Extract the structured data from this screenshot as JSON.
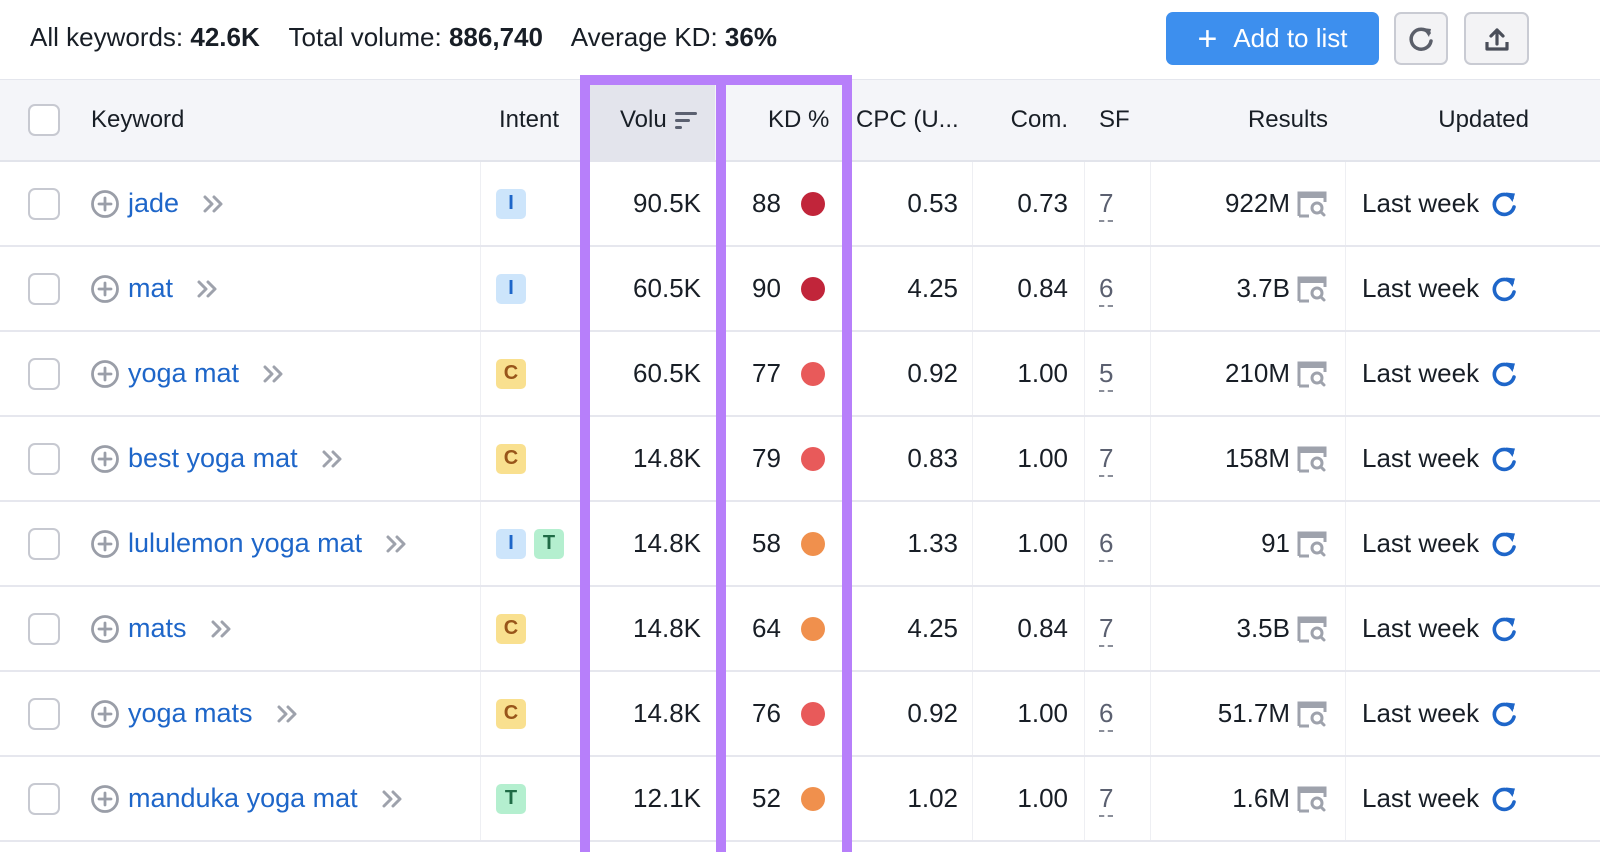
{
  "summary": {
    "all_keywords_label": "All keywords:",
    "all_keywords_value": "42.6K",
    "total_volume_label": "Total volume:",
    "total_volume_value": "886,740",
    "average_kd_label": "Average KD:",
    "average_kd_value": "36%"
  },
  "toolbar": {
    "add_to_list_icon": "plus-icon",
    "add_to_list_label": "Add to list",
    "refresh_icon": "refresh-icon",
    "export_icon": "export-upload-icon"
  },
  "colors": {
    "accent_blue": "#3d8fee",
    "link_blue": "#1e66c9",
    "highlight_purple": "#b77ffa",
    "kd_very_hard": "#c1253a",
    "kd_hard": "#e85a5a",
    "kd_difficult": "#f0904d",
    "intent_I_bg": "#cde5fb",
    "intent_I_fg": "#1e66c9",
    "intent_C_bg": "#f9e08f",
    "intent_C_fg": "#98551a",
    "intent_T_bg": "#b4efcf",
    "intent_T_fg": "#1f6b45"
  },
  "table": {
    "columns": {
      "keyword": "Keyword",
      "intent": "Intent",
      "volume": "Volu",
      "kd": "KD %",
      "cpc": "CPC (U...",
      "com": "Com.",
      "sf": "SF",
      "results": "Results",
      "updated": "Updated"
    },
    "sorted_column": "volume",
    "rows": [
      {
        "keyword": "jade",
        "intents": [
          "I"
        ],
        "volume": "90.5K",
        "kd": "88",
        "kd_level": "very_hard",
        "cpc": "0.53",
        "com": "0.73",
        "sf": "7",
        "results": "922M",
        "updated": "Last week"
      },
      {
        "keyword": "mat",
        "intents": [
          "I"
        ],
        "volume": "60.5K",
        "kd": "90",
        "kd_level": "very_hard",
        "cpc": "4.25",
        "com": "0.84",
        "sf": "6",
        "results": "3.7B",
        "updated": "Last week"
      },
      {
        "keyword": "yoga mat",
        "intents": [
          "C"
        ],
        "volume": "60.5K",
        "kd": "77",
        "kd_level": "hard",
        "cpc": "0.92",
        "com": "1.00",
        "sf": "5",
        "results": "210M",
        "updated": "Last week"
      },
      {
        "keyword": "best yoga mat",
        "intents": [
          "C"
        ],
        "volume": "14.8K",
        "kd": "79",
        "kd_level": "hard",
        "cpc": "0.83",
        "com": "1.00",
        "sf": "7",
        "results": "158M",
        "updated": "Last week"
      },
      {
        "keyword": "lululemon yoga mat",
        "intents": [
          "I",
          "T"
        ],
        "volume": "14.8K",
        "kd": "58",
        "kd_level": "difficult",
        "cpc": "1.33",
        "com": "1.00",
        "sf": "6",
        "results": "91",
        "updated": "Last week"
      },
      {
        "keyword": "mats",
        "intents": [
          "C"
        ],
        "volume": "14.8K",
        "kd": "64",
        "kd_level": "difficult",
        "cpc": "4.25",
        "com": "0.84",
        "sf": "7",
        "results": "3.5B",
        "updated": "Last week"
      },
      {
        "keyword": "yoga mats",
        "intents": [
          "C"
        ],
        "volume": "14.8K",
        "kd": "76",
        "kd_level": "hard",
        "cpc": "0.92",
        "com": "1.00",
        "sf": "6",
        "results": "51.7M",
        "updated": "Last week"
      },
      {
        "keyword": "manduka yoga mat",
        "intents": [
          "T"
        ],
        "volume": "12.1K",
        "kd": "52",
        "kd_level": "difficult",
        "cpc": "1.02",
        "com": "1.00",
        "sf": "7",
        "results": "1.6M",
        "updated": "Last week"
      }
    ]
  }
}
